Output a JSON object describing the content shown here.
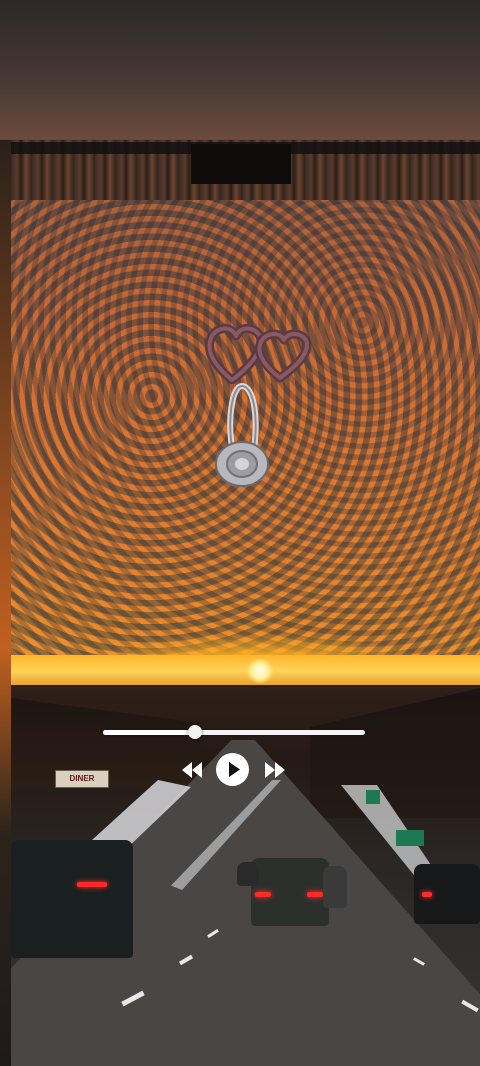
{
  "scene": {
    "billboard_text": "DINER",
    "palette": {
      "sky_top": "#6e4a3c",
      "sky_horizon": "#ffc43a",
      "sun": "#fff3a0",
      "road": "#4a4644"
    }
  },
  "decorations": {
    "hearts_icon": "double-heart-icon",
    "headphones_icon": "headphones-icon"
  },
  "player": {
    "progress": 0.35,
    "controls": {
      "previous_icon": "rewind-icon",
      "play_icon": "play-icon",
      "next_icon": "fast-forward-icon"
    },
    "accent_color": "#ffffff"
  }
}
